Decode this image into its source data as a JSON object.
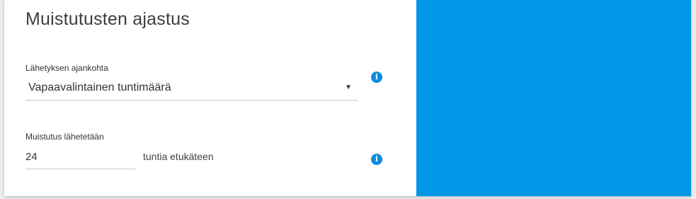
{
  "section": {
    "title": "Muistutusten ajastus"
  },
  "send_time": {
    "label": "Lähetyksen ajankohta",
    "selected": "Vapaavalintainen tuntimäärä",
    "arrow": "▼"
  },
  "reminder": {
    "label": "Muistutus lähetetään",
    "hours_value": "24",
    "suffix": "tuntia etukäteen"
  },
  "icons": {
    "info_glyph": "i",
    "info_icon_name": "info-icon"
  },
  "colors": {
    "accent_blue": "#0097e6",
    "info_blue": "#0c8ae0"
  }
}
